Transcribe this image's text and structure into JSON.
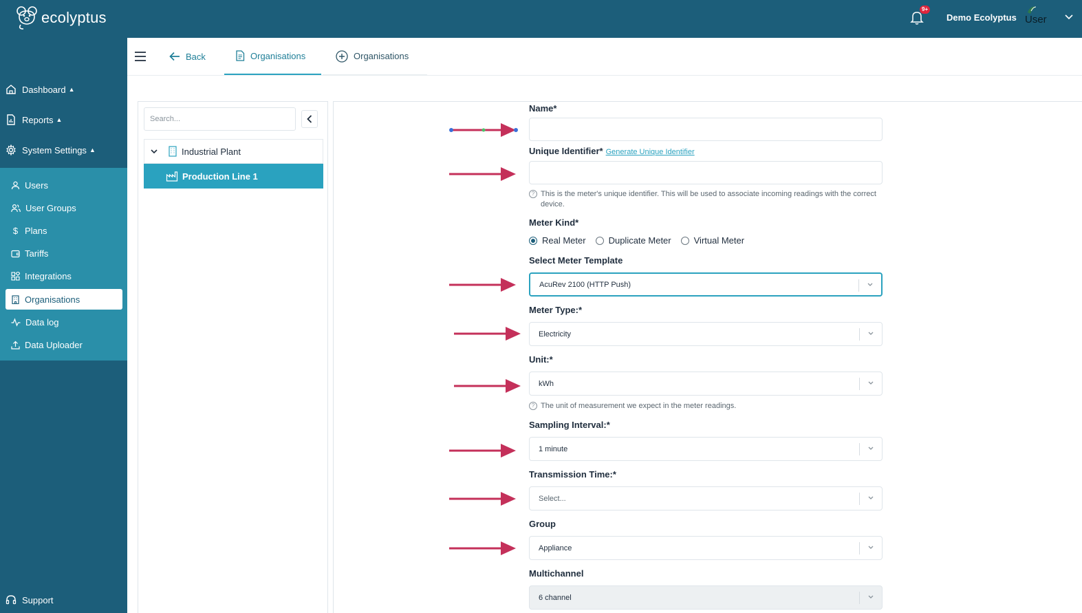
{
  "brand": {
    "name": "ecolyptus"
  },
  "topbar": {
    "notification_badge": "9+",
    "user_name": "Demo Ecolyptus",
    "user_role": "User"
  },
  "sidebar": {
    "top_items": [
      {
        "label": "Dashboard",
        "icon": "home-icon"
      },
      {
        "label": "Reports",
        "icon": "report-icon"
      },
      {
        "label": "System Settings",
        "icon": "gear-icon"
      }
    ],
    "sub_items": [
      {
        "label": "Users",
        "icon": "user-icon"
      },
      {
        "label": "User Groups",
        "icon": "users-icon"
      },
      {
        "label": "Plans",
        "icon": "dollar-icon"
      },
      {
        "label": "Tariffs",
        "icon": "wallet-icon"
      },
      {
        "label": "Integrations",
        "icon": "integrations-icon"
      },
      {
        "label": "Organisations",
        "icon": "building-icon",
        "active": true
      },
      {
        "label": "Data log",
        "icon": "activity-icon"
      },
      {
        "label": "Data Uploader",
        "icon": "upload-icon"
      }
    ],
    "support": "Support"
  },
  "tabs": {
    "back": "Back",
    "active": "Organisations",
    "add": "Organisations"
  },
  "tree": {
    "search_placeholder": "Search...",
    "parent": "Industrial Plant",
    "child": "Production Line 1"
  },
  "form": {
    "name_label": "Name*",
    "name_value": "",
    "uid_label": "Unique Identifier*",
    "uid_link": "Generate Unique Identifier",
    "uid_value": "",
    "uid_help": "This is the meter's unique identifier. This will be used to associate incoming readings with the correct device.",
    "meter_kind_label": "Meter Kind*",
    "meter_kinds": [
      "Real Meter",
      "Duplicate Meter",
      "Virtual Meter"
    ],
    "meter_kind_selected": "Real Meter",
    "template_label": "Select Meter Template",
    "template_value": "AcuRev 2100 (HTTP Push)",
    "meter_type_label": "Meter Type:*",
    "meter_type_value": "Electricity",
    "unit_label": "Unit:*",
    "unit_value": "kWh",
    "unit_help": "The unit of measurement we expect in the meter readings.",
    "sampling_label": "Sampling Interval:*",
    "sampling_value": "1 minute",
    "transmission_label": "Transmission Time:*",
    "transmission_placeholder": "Select...",
    "group_label": "Group",
    "group_value": "Appliance",
    "multichannel_label": "Multichannel",
    "multichannel_value": "6 channel"
  },
  "colors": {
    "primary": "#1c5e7a",
    "accent": "#2aa2bf",
    "arrow": "#c4305a",
    "badge": "#e0253c"
  }
}
